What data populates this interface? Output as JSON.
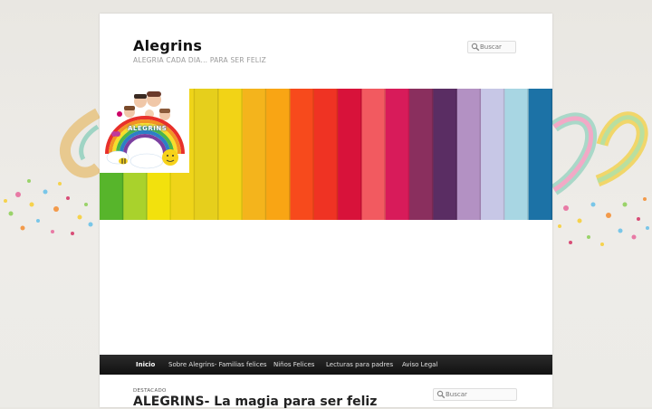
{
  "site": {
    "title": "Alegrins",
    "description": "ALEGRIA CADA DIA... PARA SER FELIZ"
  },
  "search": {
    "header_placeholder": "Buscar",
    "sidebar_placeholder": "Buscar"
  },
  "banner": {
    "logo_text": "ALEGRINS",
    "stripe_colors": [
      "#57b52b",
      "#a9d22c",
      "#f2e10d",
      "#efd419",
      "#e6cf1c",
      "#f2d316",
      "#f4b41c",
      "#f9a514",
      "#f74a1c",
      "#ef3323",
      "#d8123a",
      "#f25a60",
      "#d81b5a",
      "#8a2f5e",
      "#5a2d63",
      "#b391c3",
      "#c7c7e6",
      "#a8d6e3",
      "#1c72a6"
    ]
  },
  "nav": {
    "items": [
      {
        "label": "Inicio",
        "active": true
      },
      {
        "label": "Sobre Alegrins- Familias felices",
        "active": false
      },
      {
        "label": "Niños Felices",
        "active": false
      },
      {
        "label": "Lecturas para padres",
        "active": false
      },
      {
        "label": "Aviso Legal",
        "active": false
      }
    ]
  },
  "main": {
    "featured_label": "DESTACADO",
    "post_title": "ALEGRINS- La magia para ser feliz"
  }
}
